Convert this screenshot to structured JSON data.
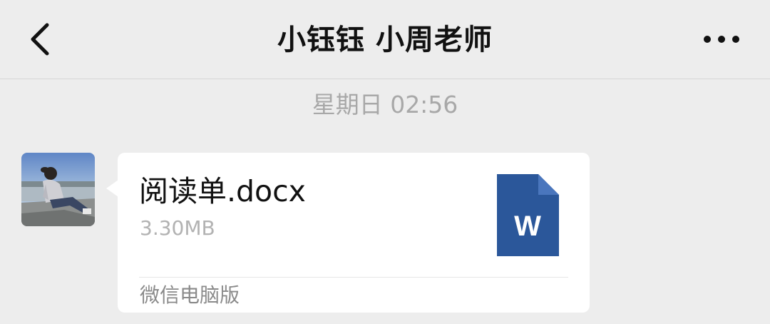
{
  "header": {
    "title": "小钰钰 小周老师",
    "back_icon": "chevron-left-icon",
    "more_icon": "more-dots-icon"
  },
  "timestamp": "星期日 02:56",
  "message": {
    "file": {
      "name": "阅读单.docx",
      "size": "3.30MB",
      "icon": "word-document-icon",
      "icon_letter": "W",
      "icon_color": "#2b579a",
      "icon_fold_color": "#4a76bd"
    },
    "source": "微信电脑版"
  },
  "colors": {
    "background": "#ededed",
    "bubble": "#ffffff",
    "timestamp": "#a8a8a8"
  }
}
